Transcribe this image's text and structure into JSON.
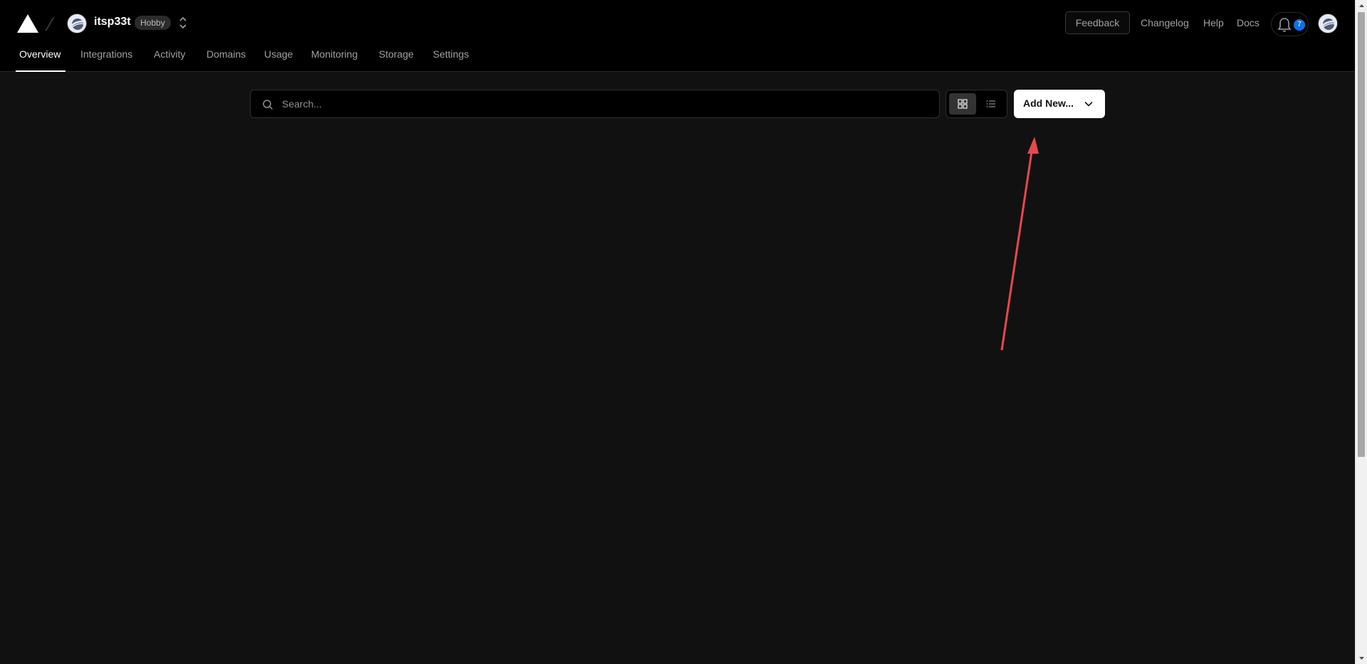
{
  "header": {
    "team_name": "itsp33t",
    "plan": "Hobby",
    "feedback_label": "Feedback",
    "links": [
      "Changelog",
      "Help",
      "Docs"
    ],
    "notification_count": "7"
  },
  "tabs": [
    {
      "label": "Overview",
      "active": true
    },
    {
      "label": "Integrations",
      "active": false
    },
    {
      "label": "Activity",
      "active": false
    },
    {
      "label": "Domains",
      "active": false
    },
    {
      "label": "Usage",
      "active": false
    },
    {
      "label": "Monitoring",
      "active": false
    },
    {
      "label": "Storage",
      "active": false
    },
    {
      "label": "Settings",
      "active": false
    }
  ],
  "toolbar": {
    "search_placeholder": "Search...",
    "add_new_label": "Add New...",
    "view_mode": "grid"
  },
  "colors": {
    "background": "#111111",
    "header_background": "#000000",
    "accent_badge": "#0a72ef",
    "annotation_arrow": "#e5484d"
  }
}
